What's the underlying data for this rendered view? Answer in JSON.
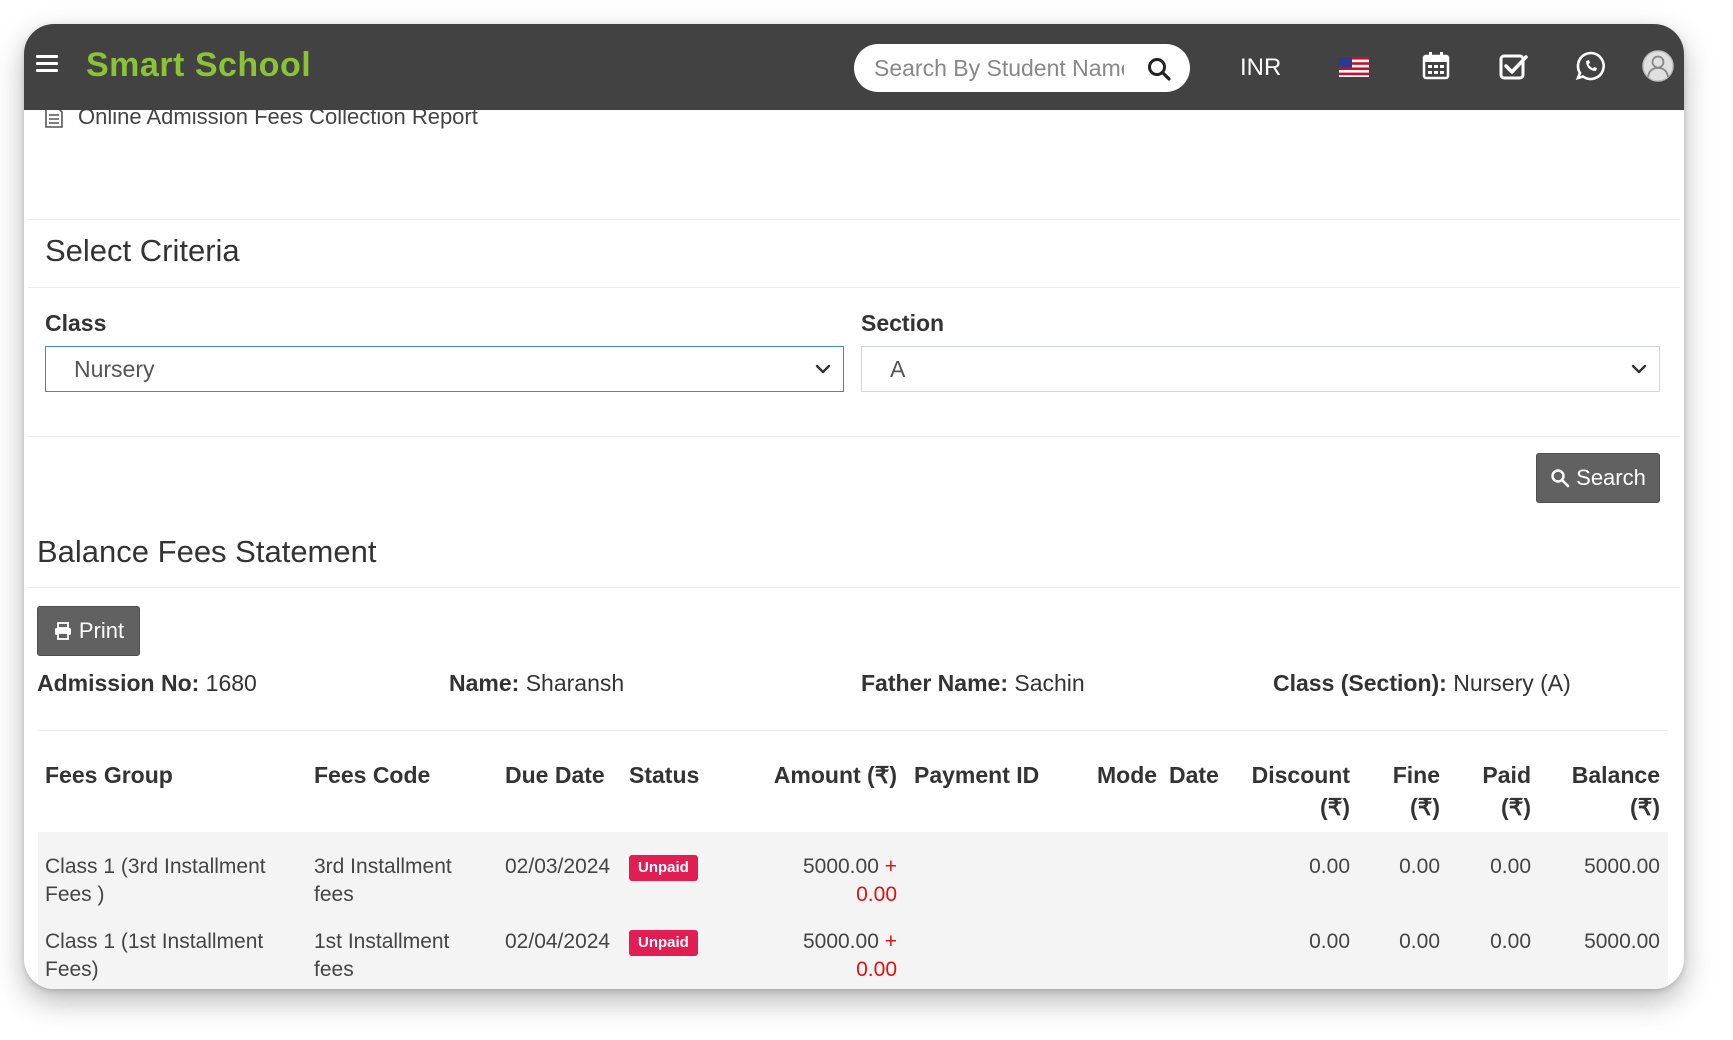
{
  "app": {
    "brand": "Smart School",
    "search_placeholder": "Search By Student Name",
    "currency": "INR"
  },
  "breadcrumb": "Online Admission Fees Collection Report",
  "criteria": {
    "title": "Select Criteria",
    "class_label": "Class",
    "class_value": "Nursery",
    "section_label": "Section",
    "section_value": "A",
    "search_button": "Search"
  },
  "statement": {
    "title": "Balance Fees Statement",
    "print_button": "Print",
    "admission_no_label": "Admission No:",
    "admission_no": "1680",
    "name_label": "Name:",
    "name": "Sharansh",
    "father_label": "Father Name:",
    "father": "Sachin",
    "class_section_label": "Class (Section):",
    "class_section": "Nursery (A)"
  },
  "table": {
    "headers": {
      "fees_group": "Fees Group",
      "fees_code": "Fees Code",
      "due_date": "Due Date",
      "status": "Status",
      "amount": "Amount (₹)",
      "payment_id": "Payment ID",
      "mode": "Mode",
      "date": "Date",
      "discount_1": "Discount",
      "discount_2": "(₹)",
      "fine_1": "Fine",
      "fine_2": "(₹)",
      "paid_1": "Paid",
      "paid_2": "(₹)",
      "balance_1": "Balance",
      "balance_2": "(₹)"
    },
    "rows": [
      {
        "group_1": "Class 1 (3rd Installment",
        "group_2": "Fees )",
        "code_1": "3rd Installment",
        "code_2": "fees",
        "due_date": "02/03/2024",
        "status": "Unpaid",
        "amount": "5000.00",
        "amount_plus": "+",
        "amount_fine": "0.00",
        "discount": "0.00",
        "fine": "0.00",
        "paid": "0.00",
        "balance": "5000.00"
      },
      {
        "group_1": "Class 1 (1st Installment",
        "group_2": "Fees)",
        "code_1": "1st Installment",
        "code_2": "fees",
        "due_date": "02/04/2024",
        "status": "Unpaid",
        "amount": "5000.00",
        "amount_plus": "+",
        "amount_fine": "0.00",
        "discount": "0.00",
        "fine": "0.00",
        "paid": "0.00",
        "balance": "5000.00"
      }
    ]
  },
  "colors": {
    "topbar": "#424242",
    "brand": "#8ac434",
    "unpaid_badge": "#e11d53",
    "fine_text": "#e21010"
  },
  "icons": [
    "menu-icon",
    "search-icon",
    "us-flag-icon",
    "calendar-icon",
    "task-check-icon",
    "whatsapp-icon",
    "user-avatar-icon",
    "document-icon",
    "chevron-down-icon",
    "print-icon"
  ]
}
